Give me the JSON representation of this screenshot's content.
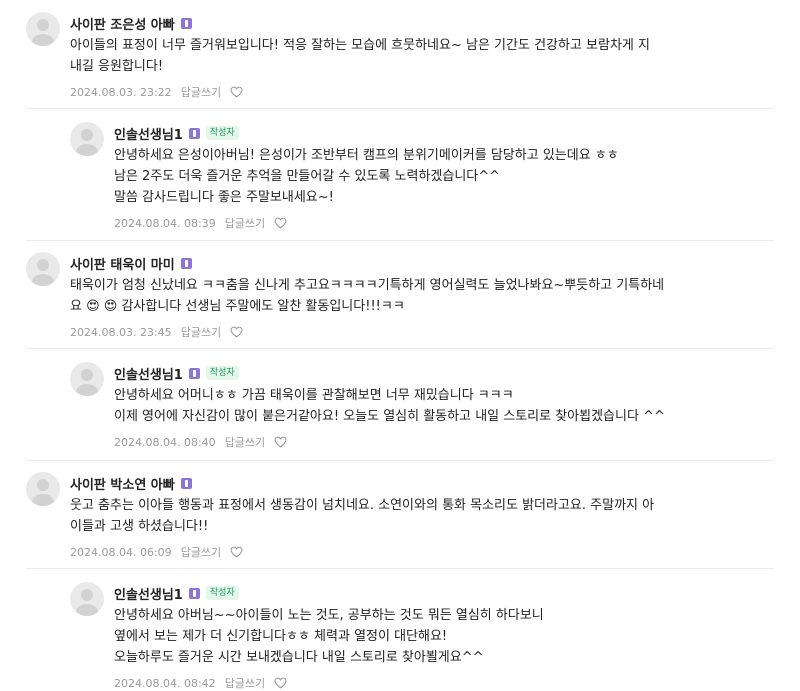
{
  "comments": [
    {
      "author": "사이판 조은성 아빠",
      "writer_badge": "",
      "lines": [
        "아이들의 표정이 너무 즐거워보입니다! 적응 잘하는 모습에 흐뭇하네요~ 남은 기간도 건강하고 보람차게 지",
        "내길 응원합니다!"
      ],
      "date": "2024.08.03. 23:22",
      "reply_label": "답글쓰기"
    },
    {
      "author": "인솔선생님1",
      "writer_badge": "작성자",
      "lines": [
        "안녕하세요 은성이아버님! 은성이가 조반부터 캠프의 분위기메이커를 담당하고 있는데요 ㅎㅎ",
        "남은 2주도 더욱 즐거운 추억을 만들어갈 수 있도록 노력하겠습니다^^",
        "말씀 감사드립니다 좋은 주말보내세요~!"
      ],
      "date": "2024.08.04. 08:39",
      "reply_label": "답글쓰기"
    },
    {
      "author": "사이판 태욱이 마미",
      "writer_badge": "",
      "lines": [
        "태욱이가 엄청 신났네요 ㅋㅋ춤을 신나게 추고요ㅋㅋㅋㅋ기특하게 영어실력도 늘었나봐요~뿌듯하고 기특하네",
        "요 😍 😍 감사합니다 선생님 주말에도 알찬 활동입니다!!!ㅋㅋ"
      ],
      "date": "2024.08.03. 23:45",
      "reply_label": "답글쓰기"
    },
    {
      "author": "인솔선생님1",
      "writer_badge": "작성자",
      "lines": [
        "안녕하세요 어머니ㅎㅎ 가끔 태욱이를 관찰해보면 너무 재밌습니다 ㅋㅋㅋ",
        "이제 영어에 자신감이 많이 붙은거같아요! 오늘도 열심히 활동하고 내일 스토리로 찾아뵙겠습니다 ^^"
      ],
      "date": "2024.08.04. 08:40",
      "reply_label": "답글쓰기"
    },
    {
      "author": "사이판 박소연 아빠",
      "writer_badge": "",
      "lines": [
        "웃고 춤추는 이아들 행동과 표정에서 생동감이 넘치네요. 소연이와의 통화 목소리도 밝더라고요. 주말까지 아",
        "이들과 고생 하셨습니다!!"
      ],
      "date": "2024.08.04. 06:09",
      "reply_label": "답글쓰기"
    },
    {
      "author": "인솔선생님1",
      "writer_badge": "작성자",
      "lines": [
        "안녕하세요 아버님~~아이들이 노는 것도, 공부하는 것도 뭐든 열심히 하다보니",
        "옆에서 보는 제가 더 신기합니다ㅎㅎ 체력과 열정이 대단해요!",
        "오늘하루도 즐거운 시간 보내겠습니다 내일 스토리로 찾아뵐게요^^"
      ],
      "date": "2024.08.04. 08:42",
      "reply_label": "답글쓰기"
    }
  ],
  "colors": {
    "writer_badge": "#1f9e5a",
    "level_badge": "#8e74d6",
    "meta": "#9a9a9a"
  },
  "icons": {
    "avatar": "default-avatar-icon",
    "like": "heart-icon",
    "level": "level-badge-icon"
  }
}
